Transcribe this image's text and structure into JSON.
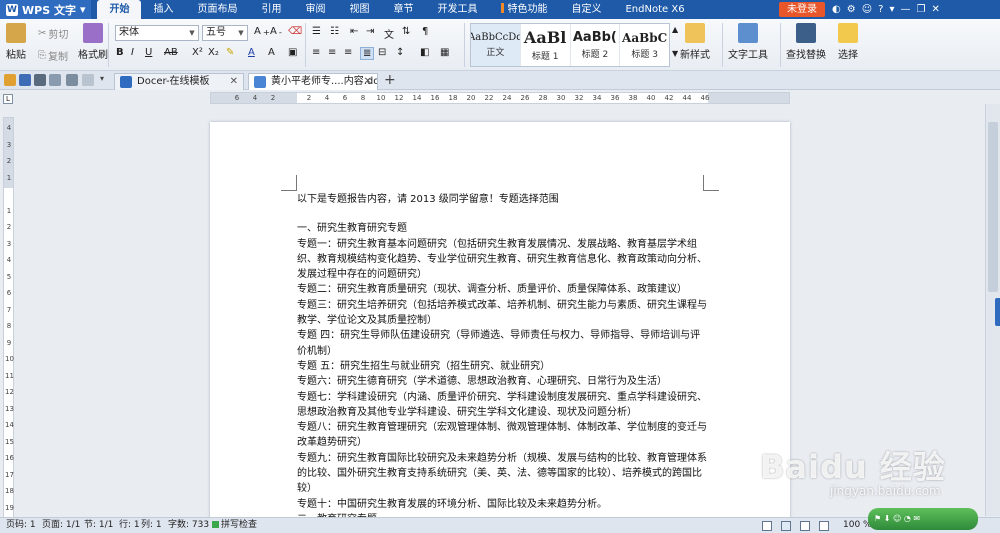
{
  "app": {
    "name": "WPS 文字",
    "login_label": "未登录"
  },
  "menu_tabs": [
    "开始",
    "插入",
    "页面布局",
    "引用",
    "审阅",
    "视图",
    "章节",
    "开发工具",
    "特色功能",
    "自定义",
    "EndNote X6"
  ],
  "ribbon": {
    "paste": "粘贴",
    "cut": "剪切",
    "copy": "复制",
    "format_painter": "格式刷",
    "font_name": "宋体",
    "font_size": "五号",
    "bold": "B",
    "italic": "I",
    "underline": "U",
    "styles": [
      {
        "preview": "AaBbCcDd",
        "caption": "正文"
      },
      {
        "preview": "AaBl",
        "caption": "标题 1"
      },
      {
        "preview": "AaBb(",
        "caption": "标题 2"
      },
      {
        "preview": "AaBbC",
        "caption": "标题 3"
      }
    ],
    "new_style": "新样式",
    "text_tools": "文字工具",
    "find_replace": "查找替换",
    "select": "选择"
  },
  "doc_tabs": [
    {
      "title": "Docer-在线模板",
      "active": false
    },
    {
      "title": "黄小平老师专....内容.doc",
      "active": true
    }
  ],
  "hruler_ticks": [
    "6",
    "4",
    "2",
    "",
    "2",
    "4",
    "6",
    "8",
    "10",
    "12",
    "14",
    "16",
    "18",
    "20",
    "22",
    "24",
    "26",
    "28",
    "30",
    "32",
    "34",
    "36",
    "38",
    "40",
    "42",
    "44",
    "46"
  ],
  "vruler_ticks": [
    "4",
    "3",
    "2",
    "1",
    "",
    "1",
    "2",
    "3",
    "4",
    "5",
    "6",
    "7",
    "8",
    "9",
    "10",
    "11",
    "12",
    "13",
    "14",
    "15",
    "16",
    "17",
    "18",
    "19"
  ],
  "document": {
    "paragraphs": [
      "以下是专题报告内容，请 2013 级同学留意！专题选择范围",
      "",
      "一、研究生教育研究专题",
      "专题一：研究生教育基本问题研究（包括研究生教育发展情况、发展战略、教育基层学术组织、教育规模结构变化趋势、专业学位研究生教育、研究生教育信息化、教育政策动向分析、发展过程中存在的问题研究）",
      "专题二：研究生教育质量研究（现状、调查分析、质量评价、质量保障体系、政策建议）",
      "专题三：研究生培养研究（包括培养模式改革、培养机制、研究生能力与素质、研究生课程与教学、学位论文及其质量控制）",
      "专题 四：研究生导师队伍建设研究（导师遴选、导师责任与权力、导师指导、导师培训与评价机制）",
      "专题 五：研究生招生与就业研究（招生研究、就业研究）",
      "专题六：研究生德育研究（学术道德、思想政治教育、心理研究、日常行为及生活）",
      "专题七：学科建设研究（内涵、质量评价研究、学科建设制度发展研究、重点学科建设研究、思想政治教育及其他专业学科建设、研究生学科文化建设、现状及问题分析）",
      "专题八：研究生教育管理研究（宏观管理体制、微观管理体制、体制改革、学位制度的变迁与改革趋势研究）",
      "专题九：研究生教育国际比较研究及未来趋势分析（规模、发展与结构的比较、教育管理体系的比较、国外研究生教育支持系统研究（美、英、法、德等国家的比较）、培养模式的跨国比较）",
      "专题十：中国研究生教育发展的环境分析、国际比较及未来趋势分析。",
      "二、教育研究专题"
    ]
  },
  "status": {
    "page_code": "页码: 1",
    "pages": "页面: 1/1",
    "section": "节: 1/1",
    "row": "行: 1",
    "col": "列: 1",
    "words": "字数: 733",
    "spell": "拼写检查",
    "zoom": "100 %"
  },
  "watermark": {
    "main": "Baidu 经验",
    "sub": "jingyan.baidu.com"
  },
  "colors": {
    "brand_blue": "#1e5aa8",
    "login_orange": "#e8562a",
    "page_bg": "#ffffff"
  }
}
